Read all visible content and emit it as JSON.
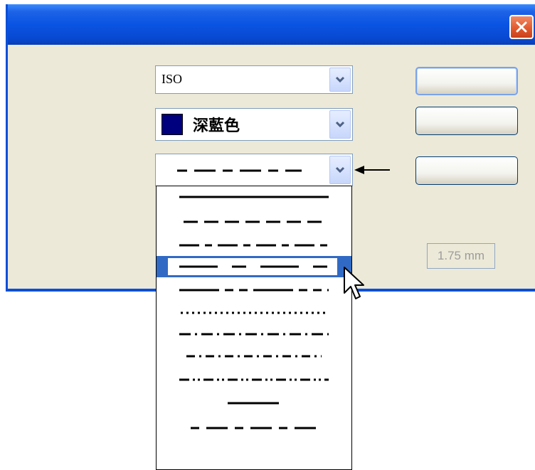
{
  "dialog": {
    "accent_color": "#0a54e3",
    "close_icon": "close-icon"
  },
  "standard_combo": {
    "value": "ISO",
    "arrow_icon": "chevron-down-icon"
  },
  "color_combo": {
    "value": "深藍色",
    "swatch_color": "#00007f",
    "arrow_icon": "chevron-down-icon"
  },
  "line_type_combo": {
    "value_icon": "dash-line-sample",
    "arrow_icon": "chevron-down-icon"
  },
  "line_width": {
    "value": "1.75 mm"
  },
  "line_type_list": {
    "items": [
      "continuous-line",
      "dashed-line",
      "long-dash-short-dash-line",
      "long-dash-dash-line",
      "long-dash-double-short-dash-line",
      "dotted-line",
      "dash-dot-line",
      "dash-dot-short-line",
      "dash-double-dot-line",
      "short-solid-line",
      "dash-long-dash-line"
    ],
    "selected_index": 3
  }
}
